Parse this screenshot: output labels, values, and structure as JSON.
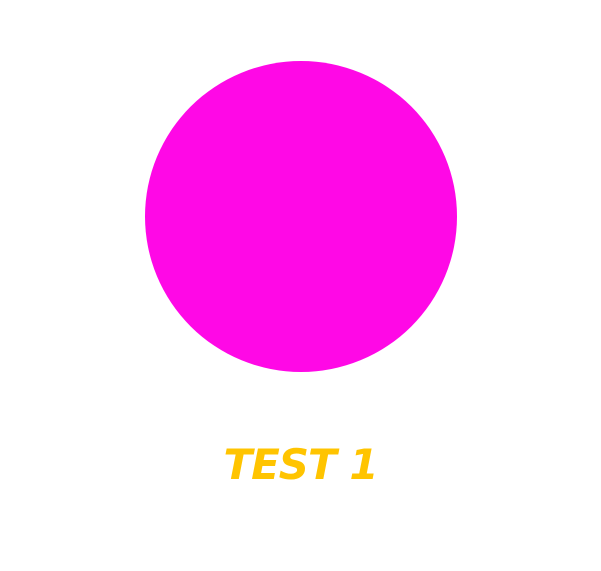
{
  "circle": {
    "color": "#ff08e6"
  },
  "label": {
    "text": "TEST 1",
    "color": "#ffc400"
  }
}
